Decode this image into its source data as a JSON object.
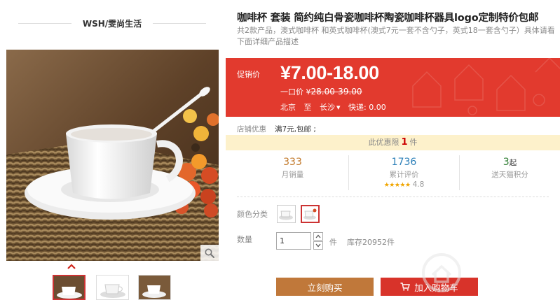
{
  "shop": {
    "name": "WSH/雯尚生活"
  },
  "product": {
    "title": "咖啡杯 套装 简约纯白骨瓷咖啡杯陶瓷咖啡杯器具logo定制特价包邮",
    "subtitle": "共2款产品，澳式咖啡杯 和英式咖啡杯(澳式7元一套不含勺子，英式18一套含勺子）具体请看下面详细产品描述"
  },
  "price": {
    "label": "促销价",
    "value": "¥7.00-18.00",
    "original_label": "一口价 ¥",
    "original_value": "28.00-39.00"
  },
  "shipping": {
    "from": "北京",
    "to_word": "至",
    "dest": "长沙",
    "dest_chevron": "▾",
    "express": "快递: 0.00"
  },
  "promo": {
    "label": "店铺优惠",
    "text": "满7元,包邮 ;"
  },
  "limit": {
    "prefix": "此优惠限",
    "count": "1",
    "suffix": "件"
  },
  "stats": {
    "monthly_sales": {
      "value": "333",
      "label": "月销量",
      "color": "#c27a2c"
    },
    "reviews": {
      "value": "1736",
      "label": "累计评价",
      "color": "#2c7fb8",
      "stars": "★★★★★",
      "score": "4.8"
    },
    "points": {
      "value": "3",
      "value_suffix": "起",
      "label": "送天猫积分",
      "color": "#2e7d32"
    }
  },
  "options": {
    "color_label": "颜色分类"
  },
  "quantity": {
    "label": "数量",
    "value": "1",
    "unit": "件",
    "stock": "库存20952件"
  },
  "actions": {
    "buy_label": "立刻购买",
    "cart_label": "加入购物车"
  },
  "icons": {
    "zoom": "magnifier-icon",
    "up": "chevron-up-icon",
    "cart": "cart-icon",
    "increment": "chevron-up-icon",
    "decrement": "chevron-down-icon"
  },
  "colors": {
    "price_bg": "#e23a2e",
    "buy_button": "#c0783a",
    "cart_button": "#d8332a",
    "limit_bg": "#fdf1cb"
  }
}
